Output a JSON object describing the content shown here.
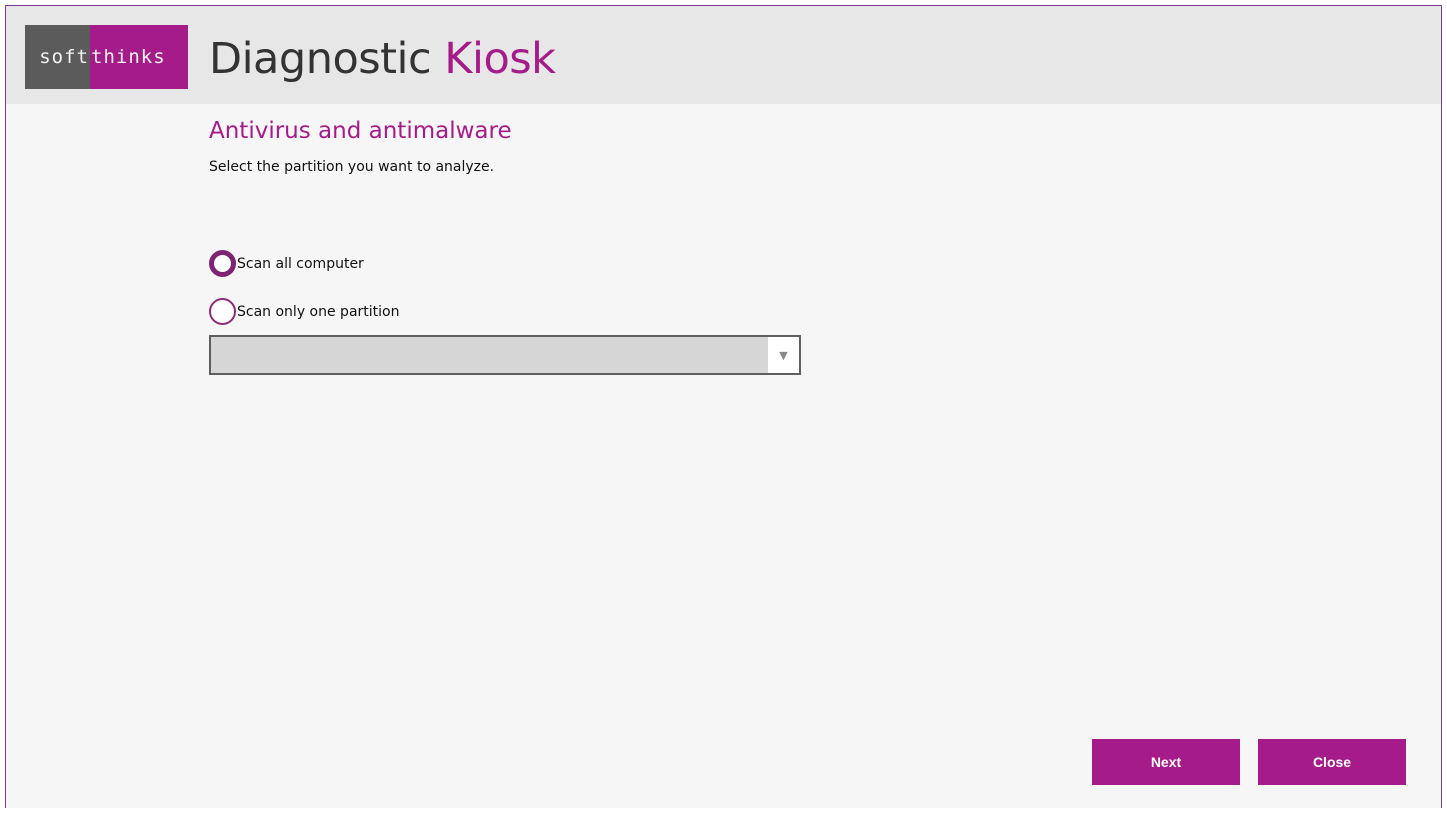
{
  "logo": {
    "left": "soft",
    "right": "thinks"
  },
  "app": {
    "title_main": "Diagnostic ",
    "title_accent": "Kiosk"
  },
  "page": {
    "section_title": "Antivirus and antimalware",
    "instruction": "Select the partition you want to analyze."
  },
  "options": {
    "scan_all": {
      "label": "Scan all computer",
      "selected": true
    },
    "scan_one": {
      "label": "Scan only one partition",
      "selected": false
    }
  },
  "partition_select": {
    "value": "",
    "arrow": "▼"
  },
  "buttons": {
    "next": "Next",
    "close": "Close"
  },
  "colors": {
    "accent": "#a51b89",
    "header_bg": "#e7e7e7",
    "body_bg": "#f6f6f6"
  }
}
